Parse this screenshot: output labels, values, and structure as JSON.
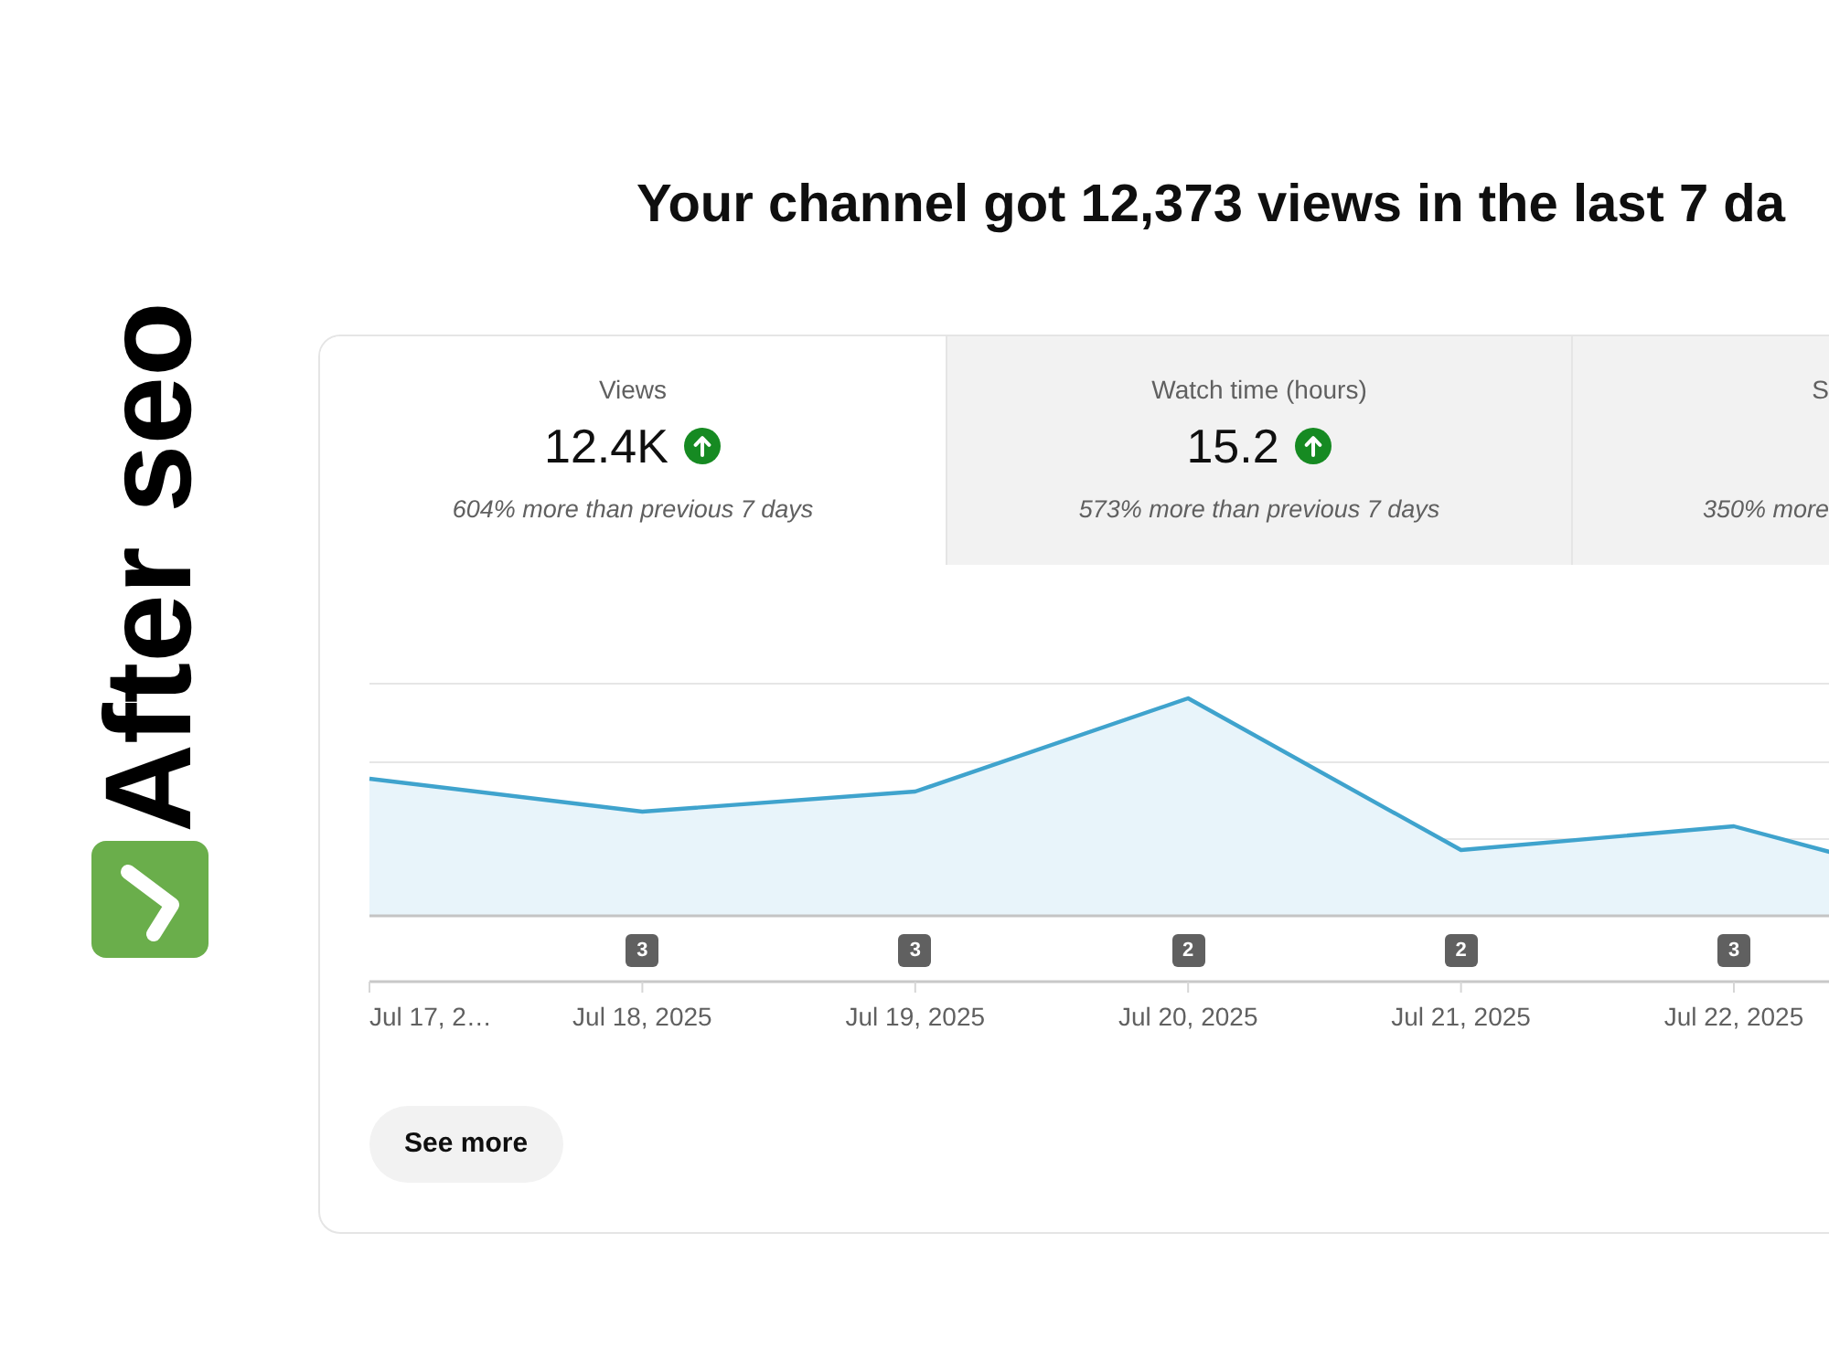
{
  "side_label": {
    "text": "After seo"
  },
  "headline": "Your channel got 12,373 views in the last 7 da",
  "metrics": [
    {
      "label": "Views",
      "value": "12.4K",
      "increase": true,
      "comparison": "604% more than previous 7 days",
      "selected": true
    },
    {
      "label": "Watch time (hours)",
      "value": "15.2",
      "increase": true,
      "comparison": "573% more than previous 7 days",
      "selected": false
    },
    {
      "label": "S",
      "comparison": "350% more",
      "selected": false
    }
  ],
  "chart": {
    "points": [
      {
        "date": "Jul 17, 2…"
      },
      {
        "date": "Jul 18, 2025",
        "badge": "3"
      },
      {
        "date": "Jul 19, 2025",
        "badge": "3"
      },
      {
        "date": "Jul 20, 2025",
        "badge": "2"
      },
      {
        "date": "Jul 21, 2025",
        "badge": "2"
      },
      {
        "date": "Jul 22, 2025",
        "badge": "3"
      }
    ]
  },
  "button": {
    "label": "See more"
  }
}
